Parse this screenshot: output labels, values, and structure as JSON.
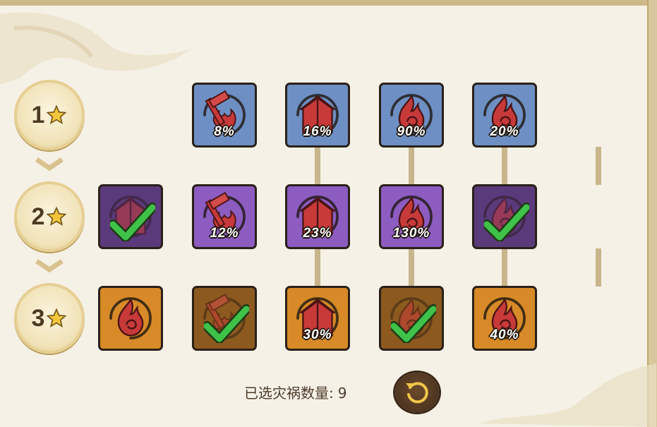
{
  "tiers": [
    {
      "number": "1"
    },
    {
      "number": "2"
    },
    {
      "number": "3"
    }
  ],
  "tiles": [
    {
      "id": "t1-c1",
      "icon": "hammer-flame-icon",
      "percent": "8%",
      "selected": false
    },
    {
      "id": "t1-c2",
      "icon": "house-icon",
      "percent": "16%",
      "selected": false
    },
    {
      "id": "t1-c3",
      "icon": "spiral-flame-icon",
      "percent": "90%",
      "selected": false
    },
    {
      "id": "t1-c4",
      "icon": "spiral-flame-icon",
      "percent": "20%",
      "selected": false
    },
    {
      "id": "t2-c0",
      "icon": "house-icon",
      "percent": "",
      "selected": true
    },
    {
      "id": "t2-c1",
      "icon": "hammer-flame-icon",
      "percent": "12%",
      "selected": false
    },
    {
      "id": "t2-c2",
      "icon": "house-icon",
      "percent": "23%",
      "selected": false
    },
    {
      "id": "t2-c3",
      "icon": "spiral-flame-icon",
      "percent": "130%",
      "selected": false
    },
    {
      "id": "t2-c4",
      "icon": "spiral-flame-icon",
      "percent": "",
      "selected": true
    },
    {
      "id": "t3-c0",
      "icon": "spiral-flame-icon",
      "percent": "",
      "selected": false
    },
    {
      "id": "t3-c1",
      "icon": "hammer-flame-icon",
      "percent": "",
      "selected": true
    },
    {
      "id": "t3-c2",
      "icon": "house-icon",
      "percent": "30%",
      "selected": false
    },
    {
      "id": "t3-c3",
      "icon": "spiral-flame-icon",
      "percent": "",
      "selected": true
    },
    {
      "id": "t3-c4",
      "icon": "spiral-flame-icon",
      "percent": "40%",
      "selected": false
    }
  ],
  "footer": {
    "label": "已选灾祸数量:",
    "count": "9"
  },
  "colors": {
    "tier1": "#6d8fc4",
    "tier2": "#8c5cc0",
    "tier3": "#d78a27",
    "icon_red": "#c83a3a",
    "check_green": "#3fc24a"
  }
}
